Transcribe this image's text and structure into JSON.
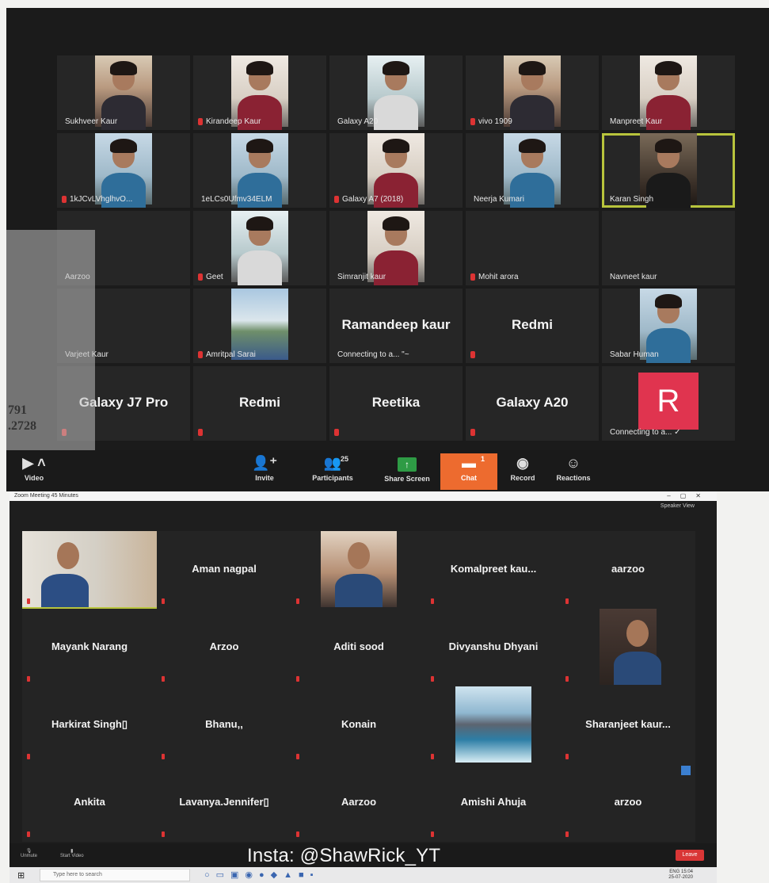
{
  "top_grid": [
    {
      "name": "Sukhveer Kaur",
      "type": "video",
      "muted": false,
      "variant": ""
    },
    {
      "name": "Kirandeep Kaur",
      "type": "video",
      "muted": true,
      "variant": "v2"
    },
    {
      "name": "Galaxy A20",
      "type": "video",
      "muted": false,
      "variant": "v5"
    },
    {
      "name": "vivo 1909",
      "type": "video",
      "muted": true,
      "variant": ""
    },
    {
      "name": "Manpreet Kaur",
      "type": "video",
      "muted": false,
      "variant": "v2"
    },
    {
      "name": "1kJCvLVhglhvO...",
      "type": "video",
      "muted": true,
      "variant": "v3"
    },
    {
      "name": "1eLCs0Ufmv34ELM",
      "type": "video",
      "muted": false,
      "variant": "v3"
    },
    {
      "name": "Galaxy A7 (2018)",
      "type": "video",
      "muted": true,
      "variant": "v2"
    },
    {
      "name": "Neerja Kumari",
      "type": "video",
      "muted": false,
      "variant": "v3"
    },
    {
      "name": "Karan Singh",
      "type": "video",
      "muted": false,
      "variant": "v4",
      "active": true
    },
    {
      "name": "Aarzoo",
      "type": "name",
      "muted": false
    },
    {
      "name": "Geet",
      "type": "video",
      "muted": true,
      "variant": "v5"
    },
    {
      "name": "Simranjit kaur",
      "type": "video",
      "muted": false,
      "variant": "v2"
    },
    {
      "name": "Mohit arora",
      "type": "empty",
      "muted": true
    },
    {
      "name": "Navneet kaur",
      "type": "empty",
      "muted": false
    },
    {
      "name": "Varjeet Kaur",
      "type": "empty",
      "muted": false
    },
    {
      "name": "Amritpal Sarai",
      "type": "video",
      "muted": true,
      "variant": "landscape"
    },
    {
      "name": "Connecting to a... \"~",
      "big": "Ramandeep kaur",
      "type": "big",
      "muted": false
    },
    {
      "name": "",
      "big": "Redmi",
      "type": "big",
      "muted": true
    },
    {
      "name": "Sabar Human",
      "type": "video",
      "muted": false,
      "variant": "v3"
    },
    {
      "name": "",
      "big": "Galaxy J7 Pro",
      "type": "big",
      "muted": true
    },
    {
      "name": "",
      "big": "Redmi",
      "type": "big",
      "muted": true
    },
    {
      "name": "",
      "big": "Reetika",
      "type": "big",
      "muted": true
    },
    {
      "name": "",
      "big": "Galaxy A20",
      "type": "big",
      "muted": true
    },
    {
      "name": "Connecting to a... ✓",
      "type": "avatar",
      "letter": "R",
      "muted": false
    }
  ],
  "top_numbers": [
    "791",
    ".2728"
  ],
  "toolbar": {
    "video": "Video",
    "invite": "Invite",
    "participants": "Participants",
    "participants_count": "25",
    "share": "Share Screen",
    "chat": "Chat",
    "chat_count": "1",
    "record": "Record",
    "reactions": "Reactions"
  },
  "bottom_window": {
    "title": "Zoom Meeting 45 Minutes",
    "speaker_view": "Speaker View",
    "watermark": "Insta: @ShawRick_YT",
    "leave": "Leave",
    "unmute": "Unmute",
    "start_video": "Start Video"
  },
  "bottom_grid": [
    {
      "name": "",
      "type": "video",
      "variant": "wide",
      "active": true
    },
    {
      "name": "Aman nagpal",
      "type": "name"
    },
    {
      "name": "",
      "type": "video",
      "variant": ""
    },
    {
      "name": "Komalpreet  kau...",
      "type": "name"
    },
    {
      "name": "aarzoo",
      "type": "name"
    },
    {
      "name": "Mayank Narang",
      "type": "name"
    },
    {
      "name": "Arzoo",
      "type": "name"
    },
    {
      "name": "Aditi sood",
      "type": "name"
    },
    {
      "name": "Divyanshu Dhyani",
      "type": "name"
    },
    {
      "name": "",
      "type": "video",
      "variant": "dark"
    },
    {
      "name": "Harkirat Singh▯",
      "type": "name"
    },
    {
      "name": "Bhanu,,",
      "type": "name"
    },
    {
      "name": "Konain",
      "type": "name"
    },
    {
      "name": "",
      "type": "video",
      "variant": "lake"
    },
    {
      "name": "Sharanjeet  kaur...",
      "type": "name"
    },
    {
      "name": "Ankita",
      "type": "name"
    },
    {
      "name": "Lavanya.Jennifer▯",
      "type": "name"
    },
    {
      "name": "Aarzoo",
      "type": "name"
    },
    {
      "name": "Amishi Ahuja",
      "type": "name"
    },
    {
      "name": "arzoo",
      "type": "name",
      "blue": true
    }
  ],
  "taskbar": {
    "search_placeholder": "Type here to search",
    "time": "15:04",
    "date": "25-07-2020",
    "lang": "ENG"
  }
}
